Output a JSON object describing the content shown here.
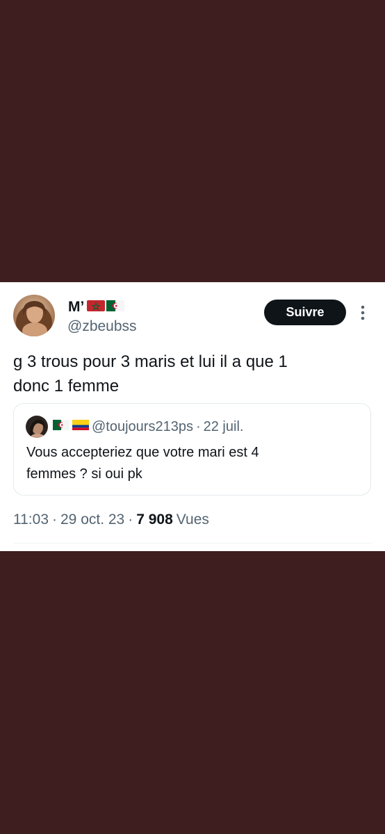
{
  "colors": {
    "page_background": "#3e1e1e",
    "card_background": "#ffffff",
    "primary_text": "#0f1419",
    "secondary_text": "#536471",
    "follow_button": "#0f1419"
  },
  "tweet": {
    "author": {
      "name": "M’",
      "name_flags": [
        "morocco-flag-icon",
        "algeria-flag-icon"
      ],
      "handle": "@zbeubss",
      "avatar": "profile-photo"
    },
    "follow_label": "Suivre",
    "more_icon": "vertical-ellipsis-icon",
    "text_lines": [
      "g 3 trous pour 3 maris et lui il a que 1",
      "donc 1 femme"
    ],
    "quoted": {
      "avatar": "profile-photo",
      "flags": [
        "algeria-flag-icon",
        "colombia-flag-icon"
      ],
      "handle": "@toujours213ps",
      "separator": "·",
      "date": "22 juil.",
      "text_lines": [
        "Vous accepteriez que votre mari est 4",
        "femmes ? si oui pk"
      ]
    },
    "meta": {
      "time": "11:03",
      "sep1": "·",
      "date": "29 oct. 23",
      "sep2": "·",
      "views_count": "7 908",
      "views_label": "Vues"
    }
  }
}
